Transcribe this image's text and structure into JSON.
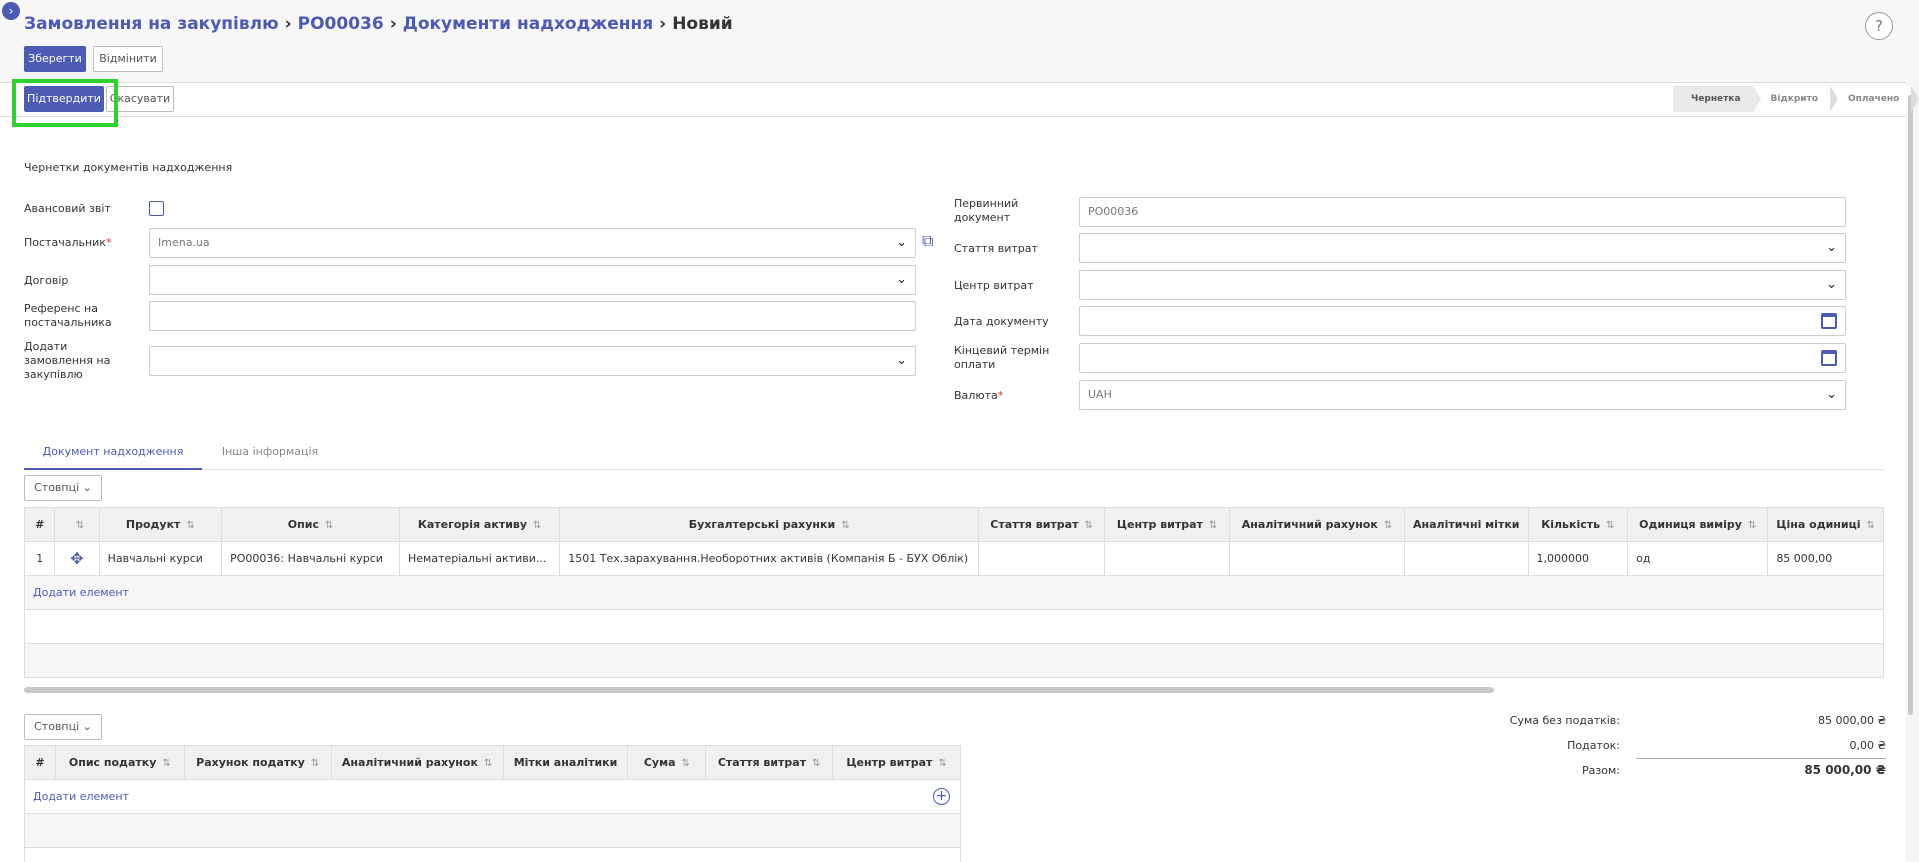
{
  "header": {
    "breadcrumb": [
      "Замовлення на закупівлю",
      "PO00036",
      "Документи надходження",
      "Новий"
    ],
    "help": "?",
    "save_label": "Зберегти",
    "discard_label": "Відмінити"
  },
  "statusbar": {
    "confirm_label": "Підтвердити",
    "cancel_label": "Скасувати",
    "steps": [
      "Чернетка",
      "Відкрито",
      "Оплачено"
    ],
    "active_step": "Чернетка"
  },
  "form": {
    "subtitle": "Чернетки документів надходження",
    "advance_report_label": "Авансовий звіт",
    "supplier_label": "Постачальник",
    "supplier_value": "Imena.ua",
    "contract_label": "Договір",
    "supplier_ref_label": "Референс на постачальника",
    "add_po_label": "Додати замовлення на закупівлю",
    "primary_doc_label": "Первинний документ",
    "primary_doc_value": "PO00036",
    "expense_item_label": "Стаття витрат",
    "cost_center_label": "Центр витрат",
    "doc_date_label": "Дата документу",
    "due_date_label": "Кінцевий термін оплати",
    "currency_label": "Валюта",
    "currency_value": "UAH"
  },
  "tabs": [
    "Документ надходження",
    "Інша інформація"
  ],
  "lines": {
    "columns_btn": "Стовпці",
    "headers": [
      "#",
      "",
      "Продукт",
      "Опис",
      "Категорія активу",
      "Бухгалтерські рахунки",
      "Стаття витрат",
      "Центр витрат",
      "Аналітичний рахунок",
      "Аналітичні мітки",
      "Кількість",
      "Одиниця виміру",
      "Ціна одиниці"
    ],
    "rows": [
      [
        "1",
        "",
        "Навчальні курси",
        "PO00036: Навчальні курси",
        "Нематеріальні активи...",
        "1501 Тех.зарахування.Необоротних активів (Компанія Б - БУХ Облік)",
        "",
        "",
        "",
        "",
        "1,000000",
        "од",
        "85 000,00"
      ]
    ],
    "add_item": "Додати елемент"
  },
  "taxes": {
    "columns_btn": "Стовпці",
    "headers": [
      "#",
      "Опис податку",
      "Рахунок податку",
      "Аналітичний рахунок",
      "Мітки аналітики",
      "Сума",
      "Стаття витрат",
      "Центр витрат"
    ],
    "add_item": "Додати елемент"
  },
  "totals": {
    "untaxed_label": "Сума без податків:",
    "untaxed_value": "85 000,00 ₴",
    "tax_label": "Податок:",
    "tax_value": "0,00 ₴",
    "total_label": "Разом:",
    "total_value": "85 000,00 ₴"
  }
}
